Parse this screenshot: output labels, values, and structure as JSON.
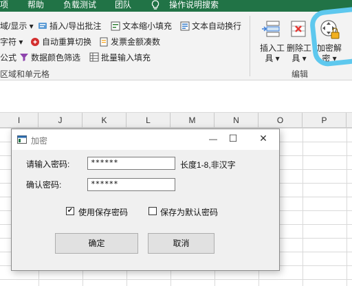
{
  "menu": {
    "items": [
      "项",
      "帮助",
      "负载测试",
      "团队",
      "操作说明搜索"
    ],
    "lightbulb_icon": "lightbulb-icon"
  },
  "ribbon": {
    "left_cut": {
      "row1": "域/显示",
      "row2": "字符",
      "row3": "公式",
      "group_label": "区域和单元格"
    },
    "commands": {
      "insert_export_annotation": "插入/导出批注",
      "text_shrink_fill": "文本缩小填充",
      "text_auto_wrap": "文本自动换行",
      "auto_recalc": "自动重算切换",
      "invoice_amount": "发票金额凑数",
      "data_color_filter": "数据颜色筛选",
      "batch_input_fill": "批量输入填充"
    },
    "big_buttons": {
      "insert_tool_line1": "插入工",
      "insert_tool_line2": "具",
      "delete_tool_line1": "删除工",
      "delete_tool_line2": "具",
      "encrypt_line1": "加密解",
      "encrypt_line2": "密"
    },
    "edit_group_label": "编辑",
    "accent_color": "#217346"
  },
  "sheet": {
    "columns": [
      "I",
      "J",
      "K",
      "L",
      "M",
      "N",
      "O",
      "P"
    ]
  },
  "dialog": {
    "title": "加密",
    "password_label": "请输入密码:",
    "password_value": "******",
    "hint": "长度1-8,非汉字",
    "confirm_label": "确认密码:",
    "confirm_value": "******",
    "use_saved_label": "使用保存密码",
    "use_saved_checked": "✔",
    "save_default_label": "保存为默认密码",
    "ok_label": "确定",
    "cancel_label": "取消",
    "minimize_glyph": "—",
    "maximize_glyph": "☐",
    "close_glyph": "✕"
  }
}
